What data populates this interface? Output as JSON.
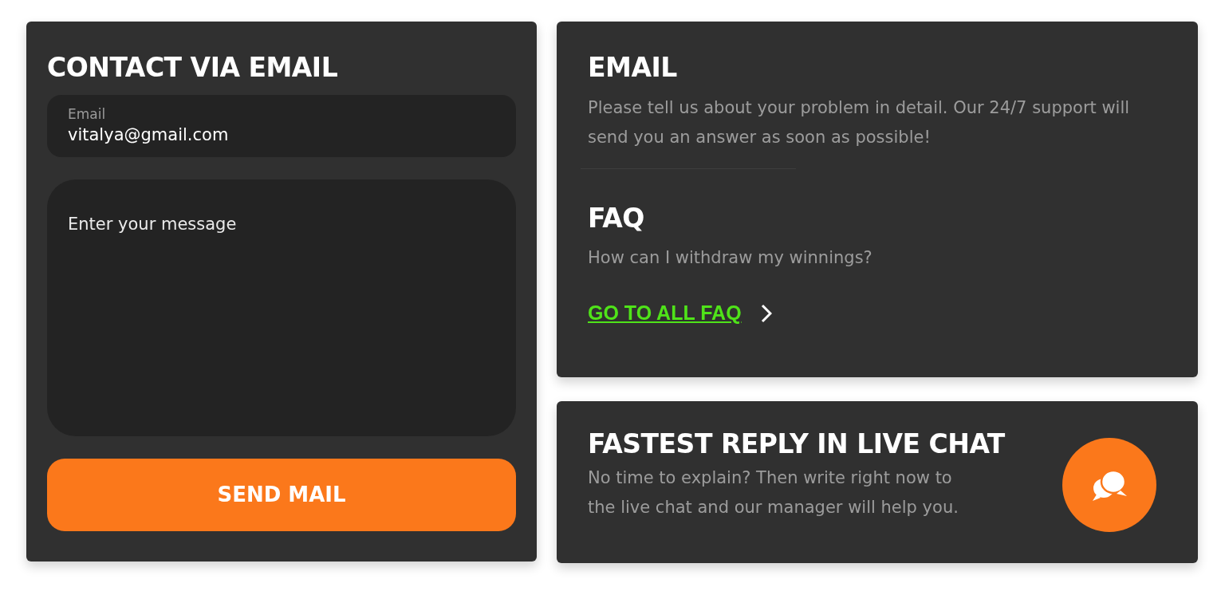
{
  "contact_form": {
    "title": "CONTACT VIA EMAIL",
    "email_field": {
      "label": "Email",
      "value": "vitalya@gmail.com"
    },
    "message_field": {
      "placeholder": "Enter your message"
    },
    "send_button": "SEND MAIL"
  },
  "info_card": {
    "email_section": {
      "title": "EMAIL",
      "text": "Please tell us about your problem in detail. Our 24/7 support will send you an answer as soon as possible!"
    },
    "faq_section": {
      "title": "FAQ",
      "question": "How can I withdraw my winnings?",
      "link": "GO TO ALL FAQ"
    }
  },
  "live_chat_card": {
    "title": "FASTEST REPLY IN LIVE CHAT",
    "text": "No time to explain? Then write right now to the live chat and our manager will help you."
  }
}
